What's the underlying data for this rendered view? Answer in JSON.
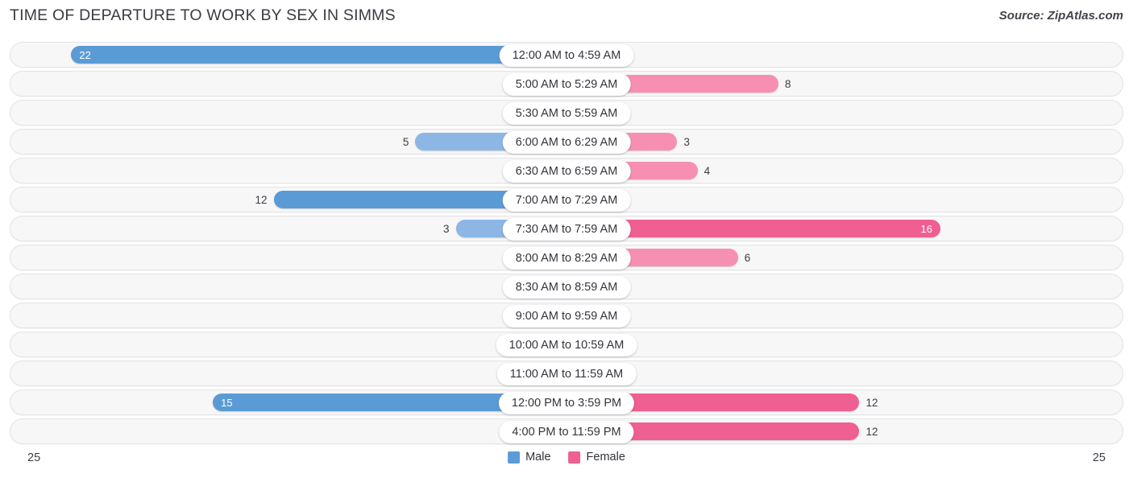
{
  "header": {
    "title": "TIME OF DEPARTURE TO WORK BY SEX IN SIMMS",
    "source": "Source: ZipAtlas.com"
  },
  "footer": {
    "axis_min_label": "25",
    "axis_max_label": "25"
  },
  "legend": {
    "items": [
      {
        "label": "Male",
        "color": "#5b9bd5"
      },
      {
        "label": "Female",
        "color": "#ef5f91"
      }
    ]
  },
  "chart_data": {
    "type": "bar",
    "orientation": "horizontal-diverging",
    "title": "TIME OF DEPARTURE TO WORK BY SEX IN SIMMS",
    "xlabel": "",
    "ylabel": "",
    "xlim": [
      25,
      25
    ],
    "axis_max": 25,
    "grid": false,
    "legend_position": "bottom-center",
    "categories": [
      "12:00 AM to 4:59 AM",
      "5:00 AM to 5:29 AM",
      "5:30 AM to 5:59 AM",
      "6:00 AM to 6:29 AM",
      "6:30 AM to 6:59 AM",
      "7:00 AM to 7:29 AM",
      "7:30 AM to 7:59 AM",
      "8:00 AM to 8:29 AM",
      "8:30 AM to 8:59 AM",
      "9:00 AM to 9:59 AM",
      "10:00 AM to 10:59 AM",
      "11:00 AM to 11:59 AM",
      "12:00 PM to 3:59 PM",
      "4:00 PM to 11:59 PM"
    ],
    "series": [
      {
        "name": "Male",
        "values": [
          22,
          0,
          0,
          5,
          0,
          12,
          3,
          0,
          0,
          0,
          0,
          0,
          15,
          0
        ]
      },
      {
        "name": "Female",
        "values": [
          0,
          8,
          0,
          3,
          4,
          0,
          16,
          6,
          0,
          0,
          0,
          0,
          12,
          12
        ]
      }
    ],
    "rows": [
      {
        "label": "12:00 AM to 4:59 AM",
        "male": 22,
        "female": 0,
        "male_text": "22",
        "female_text": "0"
      },
      {
        "label": "5:00 AM to 5:29 AM",
        "male": 0,
        "female": 8,
        "male_text": "0",
        "female_text": "8"
      },
      {
        "label": "5:30 AM to 5:59 AM",
        "male": 0,
        "female": 0,
        "male_text": "0",
        "female_text": "0"
      },
      {
        "label": "6:00 AM to 6:29 AM",
        "male": 5,
        "female": 3,
        "male_text": "5",
        "female_text": "3"
      },
      {
        "label": "6:30 AM to 6:59 AM",
        "male": 0,
        "female": 4,
        "male_text": "0",
        "female_text": "4"
      },
      {
        "label": "7:00 AM to 7:29 AM",
        "male": 12,
        "female": 0,
        "male_text": "12",
        "female_text": "0"
      },
      {
        "label": "7:30 AM to 7:59 AM",
        "male": 3,
        "female": 16,
        "male_text": "3",
        "female_text": "16"
      },
      {
        "label": "8:00 AM to 8:29 AM",
        "male": 0,
        "female": 6,
        "male_text": "0",
        "female_text": "6"
      },
      {
        "label": "8:30 AM to 8:59 AM",
        "male": 0,
        "female": 0,
        "male_text": "0",
        "female_text": "0"
      },
      {
        "label": "9:00 AM to 9:59 AM",
        "male": 0,
        "female": 0,
        "male_text": "0",
        "female_text": "0"
      },
      {
        "label": "10:00 AM to 10:59 AM",
        "male": 0,
        "female": 0,
        "male_text": "0",
        "female_text": "0"
      },
      {
        "label": "11:00 AM to 11:59 AM",
        "male": 0,
        "female": 0,
        "male_text": "0",
        "female_text": "0"
      },
      {
        "label": "12:00 PM to 3:59 PM",
        "male": 15,
        "female": 12,
        "male_text": "15",
        "female_text": "12"
      },
      {
        "label": "4:00 PM to 11:59 PM",
        "male": 0,
        "female": 12,
        "male_text": "0",
        "female_text": "12"
      }
    ]
  }
}
